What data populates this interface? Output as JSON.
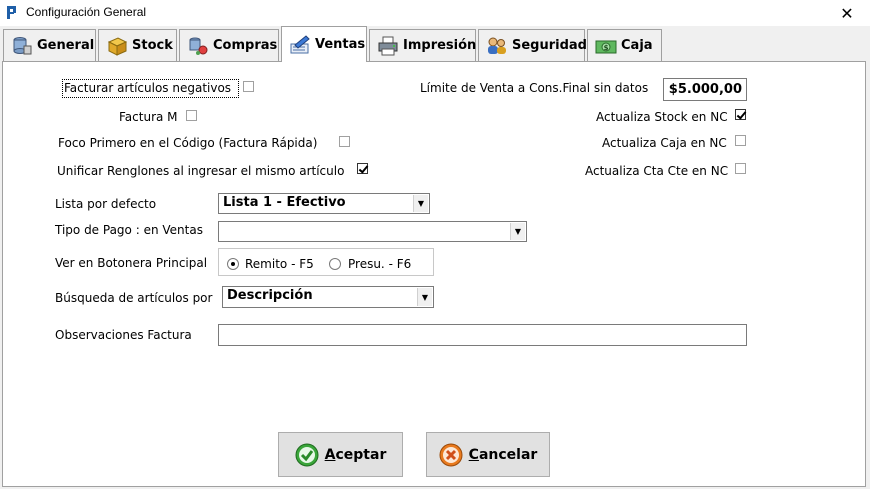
{
  "window": {
    "title": "Configuración General"
  },
  "tabs": [
    {
      "label": "General",
      "icon": "database-icon"
    },
    {
      "label": "Stock",
      "icon": "box-icon"
    },
    {
      "label": "Compras",
      "icon": "database-cart-icon"
    },
    {
      "label": "Ventas",
      "icon": "pencil-paper-icon"
    },
    {
      "label": "Impresión",
      "icon": "printer-icon"
    },
    {
      "label": "Seguridad",
      "icon": "users-icon"
    },
    {
      "label": "Caja",
      "icon": "cash-register-icon"
    }
  ],
  "ventas": {
    "facturar_negativos": {
      "label": "Facturar artículos negativos",
      "checked": false
    },
    "factura_m": {
      "label": "Factura M",
      "checked": false
    },
    "foco_codigo": {
      "label": "Foco Primero en el Código (Factura Rápida)",
      "checked": false
    },
    "unificar_renglones": {
      "label": "Unificar Renglones al ingresar el mismo artículo",
      "checked": true
    },
    "limite_venta": {
      "label": "Límite de Venta a Cons.Final sin datos",
      "value": "$5.000,00"
    },
    "actualiza_stock": {
      "label": "Actualiza Stock en NC",
      "checked": true
    },
    "actualiza_caja": {
      "label": "Actualiza Caja en NC",
      "checked": false
    },
    "actualiza_ctacte": {
      "label": "Actualiza Cta Cte en NC",
      "checked": false
    },
    "lista_defecto": {
      "label": "Lista por defecto",
      "value": "Lista 1 - Efectivo"
    },
    "tipo_pago": {
      "label": "Tipo de Pago : en Ventas",
      "value": ""
    },
    "botonera": {
      "label": "Ver en Botonera Principal",
      "option1": "Remito - F5",
      "option2": "Presu. - F6",
      "selected": "Remito - F5"
    },
    "busqueda": {
      "label": "Búsqueda de artículos por",
      "value": "Descripción"
    },
    "observaciones": {
      "label": "Observaciones Factura",
      "value": ""
    }
  },
  "buttons": {
    "aceptar_first": "A",
    "aceptar_rest": "ceptar",
    "cancelar_first": "C",
    "cancelar_rest": "ancelar"
  },
  "colors": {
    "accept_green": "#3aa53a",
    "cancel_orange": "#e87a1e"
  }
}
